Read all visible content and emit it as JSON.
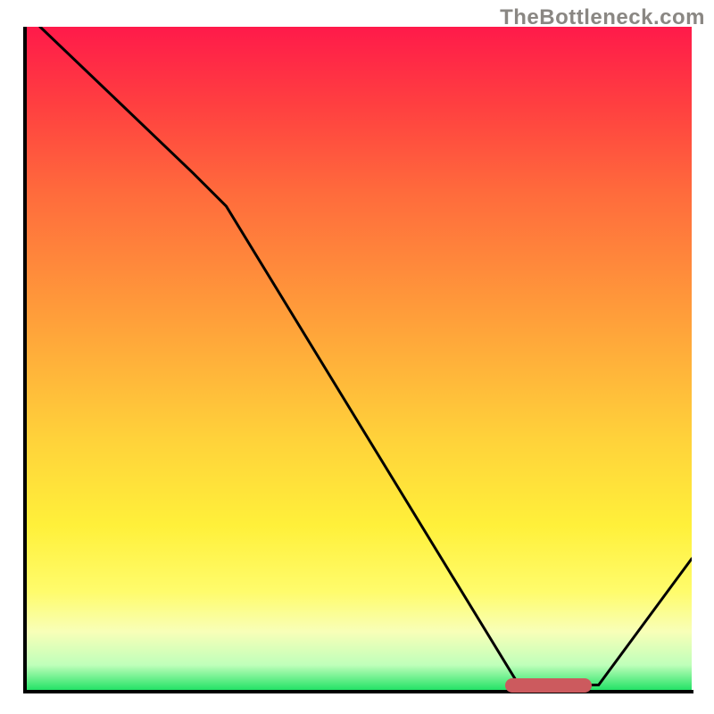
{
  "watermark": "TheBottleneck.com",
  "chart_data": {
    "type": "line",
    "title": "",
    "xlabel": "",
    "ylabel": "",
    "xlim": [
      0,
      100
    ],
    "ylim": [
      0,
      100
    ],
    "axes_visible": {
      "ticks": false,
      "grid": false
    },
    "background_gradient": {
      "direction": "vertical",
      "stops": [
        {
          "pos": 0,
          "color": "#ff1a4a"
        },
        {
          "pos": 45,
          "color": "#ffa23a"
        },
        {
          "pos": 75,
          "color": "#fff03a"
        },
        {
          "pos": 100,
          "color": "#18e060"
        }
      ]
    },
    "series": [
      {
        "name": "curve",
        "x": [
          2,
          25,
          30,
          74,
          86,
          100
        ],
        "y": [
          100,
          78,
          73,
          1,
          1,
          20
        ],
        "stroke": "#000000",
        "stroke_width": 3
      }
    ],
    "annotations": [
      {
        "name": "optimal-range-marker",
        "type": "bar-segment",
        "x_start": 72,
        "x_end": 85,
        "y": 1,
        "color": "#cc5a5e"
      }
    ]
  }
}
